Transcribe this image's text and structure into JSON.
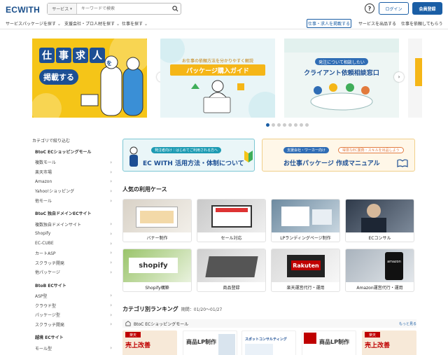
{
  "header": {
    "logo": "ECWITH",
    "search_category": "サービス",
    "search_placeholder": "キーワードで検索",
    "help": "?",
    "login": "ログイン",
    "register": "会員登録"
  },
  "nav": {
    "items": [
      {
        "label": "サービスパッケージを探す"
      },
      {
        "label": "支援会社・プロ人材を探す"
      },
      {
        "label": "仕事を探す"
      }
    ],
    "post_job": "仕事・求人を掲載する",
    "sell_service": "サービスを出品する",
    "order_work": "仕事を依頼してもらう"
  },
  "carousel": {
    "slide1": {
      "chars": [
        "仕",
        "事",
        "求",
        "人"
      ],
      "o": "を",
      "cta": "掲載する"
    },
    "slide2": {
      "sub": "お仕事の依頼方法を分かりやすく解説",
      "title": "パッケージ購入ガイド"
    },
    "slide3": {
      "sub": "発注について相談したい",
      "title": "クライアント依頼相談窓口"
    },
    "total_dots": 8,
    "active_dot": 0,
    "prev": "‹",
    "next": "›"
  },
  "sidebar": {
    "heading": "カテゴリで絞り込む",
    "groups": [
      {
        "title": "BtoC ECショッピングモール",
        "items": [
          "複数モール",
          "楽天市場",
          "Amazon",
          "Yahoo!ショッピング",
          "他モール"
        ]
      },
      {
        "title": "BtoC 独自ドメインECサイト",
        "items": [
          "複数独自ドメインサイト",
          "Shopify",
          "EC-CUBE",
          "カートASP",
          "スクラッチ開発",
          "他パッケージ"
        ]
      },
      {
        "title": "BtoB ECサイト",
        "items": [
          "ASP型",
          "クラウド型",
          "パッケージ型",
          "スクラッチ開発"
        ]
      },
      {
        "title": "越境 ECサイト",
        "items": [
          "モール型"
        ]
      }
    ]
  },
  "banners": {
    "b1": {
      "tag": "発注者向け｜はじめてご利用される方へ",
      "title": "EC WITH 活用方法・体制について"
    },
    "b2": {
      "tag": "支援会社・ワーカー向け",
      "tag2": "得意なEC業務・スキルを出品しよう",
      "title": "お仕事パッケージ 作成マニュアル"
    }
  },
  "popular": {
    "title": "人気の利用ケース",
    "cases": [
      {
        "label": "バナー制作"
      },
      {
        "label": "セール対応"
      },
      {
        "label": "LPランディングページ制作"
      },
      {
        "label": "ECコンサル"
      },
      {
        "label": "Shopify構築",
        "overlay": "shopify"
      },
      {
        "label": "商品登録"
      },
      {
        "label": "楽天運営代行・運用",
        "overlay": "Rakuten"
      },
      {
        "label": "Amazon運営代行・運用",
        "overlay": "amazon"
      }
    ]
  },
  "ranking": {
    "title": "カテゴリ別ランキング",
    "period": "期間：01/20〜01/27",
    "category": "BtoC ECショッピングモール",
    "more": "もっと見る",
    "cards": [
      {
        "top": "楽天",
        "title": "売上改善"
      },
      {
        "top": "",
        "title": "商品LP制作"
      },
      {
        "top": "",
        "title": "スポットコンサルティング"
      },
      {
        "top": "",
        "title": "商品LP制作"
      },
      {
        "top": "楽天",
        "title": "売上改善"
      }
    ]
  }
}
